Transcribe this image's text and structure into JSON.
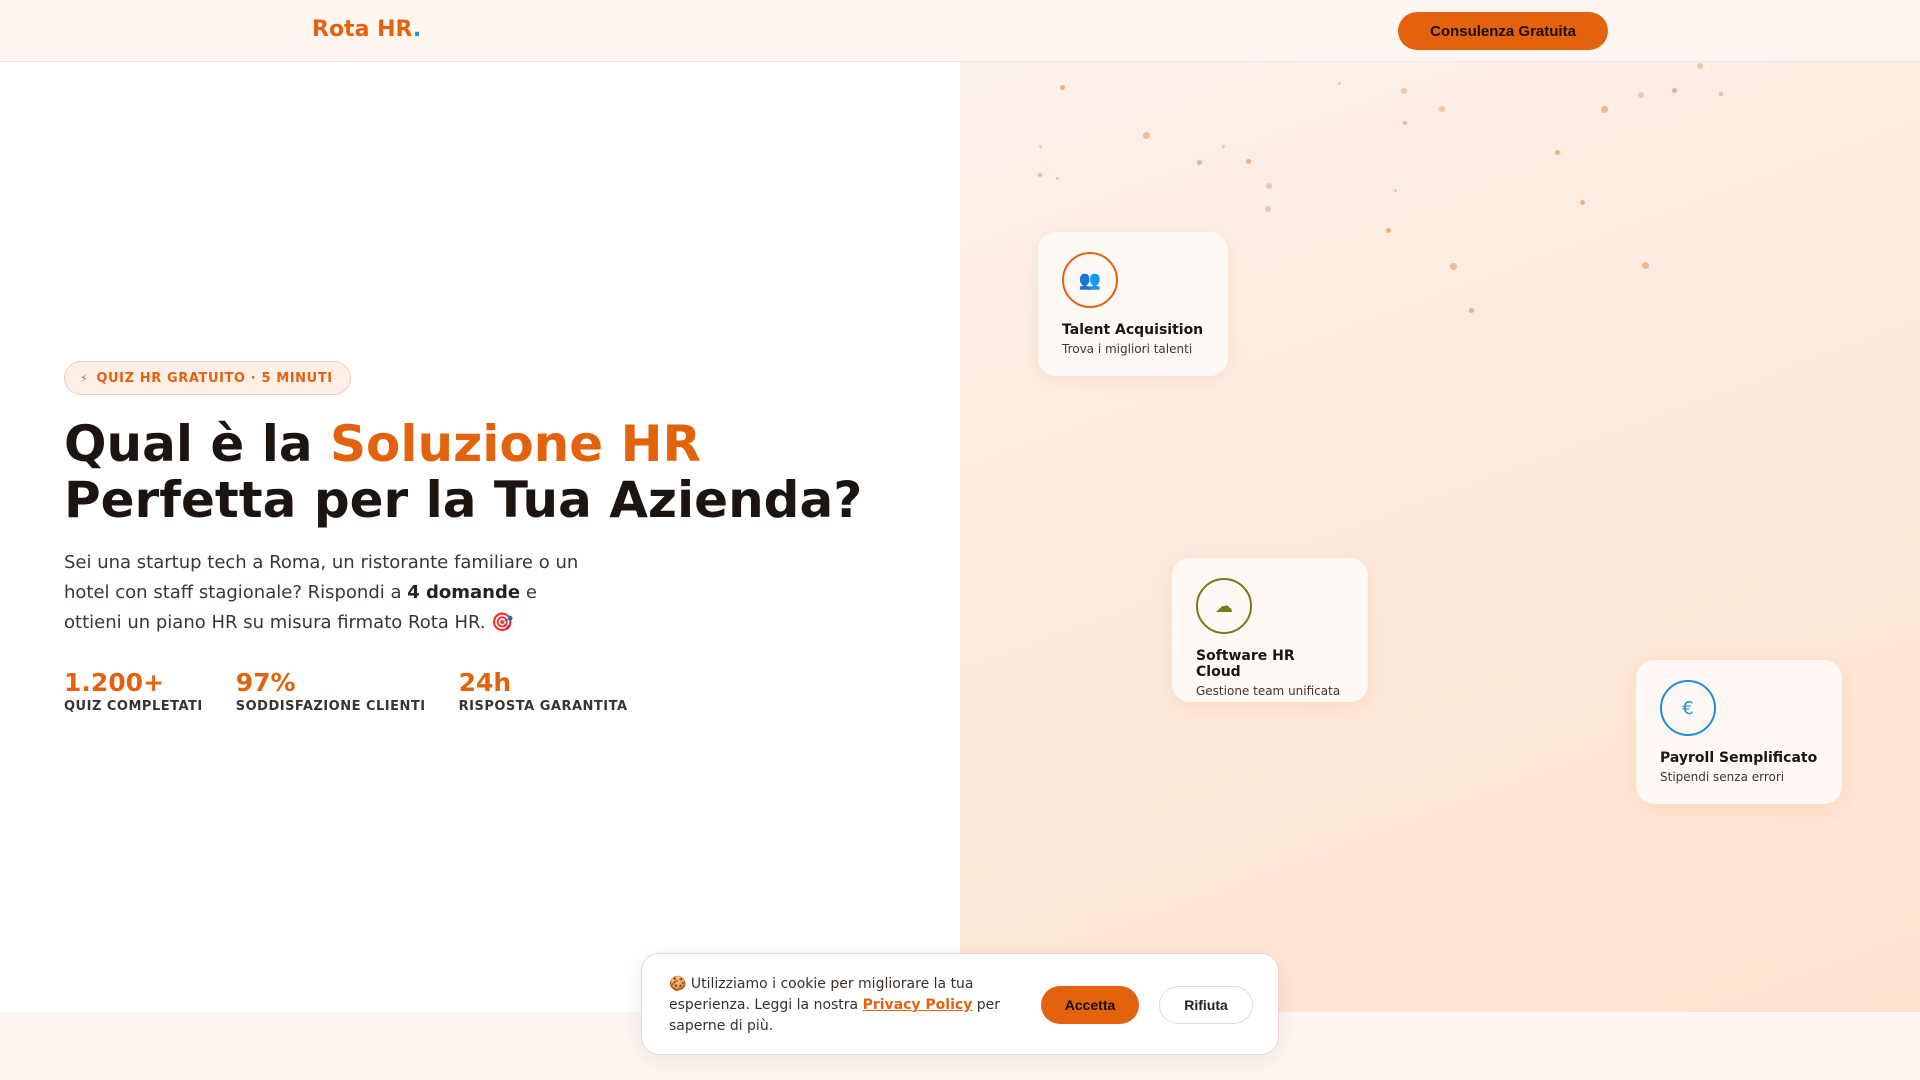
{
  "header": {
    "logo_text": "Rota HR",
    "logo_dot": ".",
    "cta_label": "Consulenza Gratuita"
  },
  "hero": {
    "badge_icon": "lightning-icon",
    "badge_text": "QUIZ HR GRATUITO · 5 MINUTI",
    "title_part1": "Qual è la ",
    "title_highlight": "Soluzione HR",
    "title_part2": " Perfetta per la Tua Azienda?",
    "desc_part1": "Sei una startup tech a Roma, un ristorante familiare o un hotel con staff stagionale? Rispondi a ",
    "desc_bold": "4 domande",
    "desc_part2": " e ottieni un piano HR su misura firmato Rota HR. 🎯",
    "stats": [
      {
        "value": "1.200+",
        "label": "QUIZ COMPLETATI"
      },
      {
        "value": "97%",
        "label": "SODDISFAZIONE CLIENTI"
      },
      {
        "value": "24h",
        "label": "RISPOSTA GARANTITA"
      }
    ]
  },
  "cards": [
    {
      "icon": "people-icon",
      "title": "Talent Acquisition",
      "subtitle": "Trova i migliori talenti",
      "accent": "#e2620e"
    },
    {
      "icon": "cloud-icon",
      "title": "Software HR Cloud",
      "subtitle": "Gestione team unificata",
      "accent": "#7a7a14"
    },
    {
      "icon": "payroll-icon",
      "title": "Payroll Semplificato",
      "subtitle": "Stipendi senza errori",
      "accent": "#1f8ed6"
    }
  ],
  "cookie": {
    "icon": "cookie-icon",
    "text_part1": "🍪 Utilizziamo i cookie per migliorare la tua esperienza. Leggi la nostra ",
    "link_text": "Privacy Policy",
    "text_part2": " per saperne di più.",
    "accept_label": "Accetta",
    "reject_label": "Rifiuta"
  },
  "colors": {
    "brand": "#e2620e",
    "accent_blue": "#1f8ed6",
    "background_warm": "#fde8d8"
  }
}
